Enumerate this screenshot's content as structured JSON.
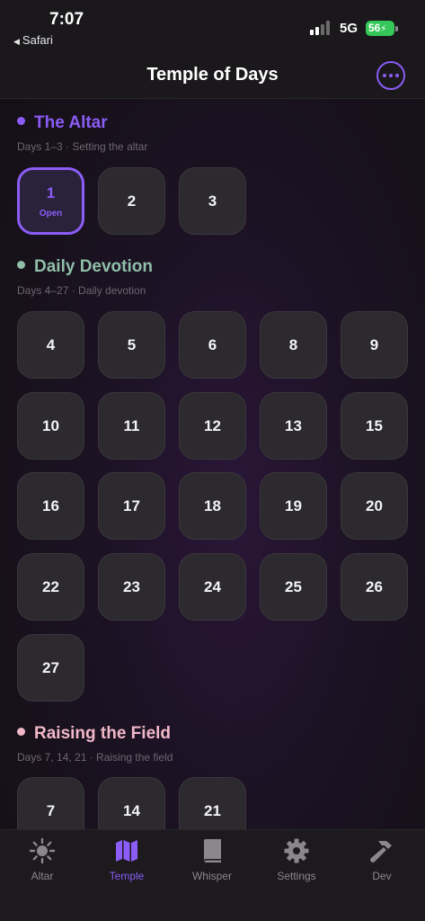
{
  "status_bar": {
    "time": "7:07",
    "back_app": "Safari",
    "network": "5G",
    "battery": "56"
  },
  "header": {
    "title": "Temple of Days",
    "accent": "#8b5cf6"
  },
  "sections": [
    {
      "title": "The Altar",
      "subtitle": "Days 1–3 · Setting the altar",
      "color": "#8b5cf6",
      "tiles": [
        {
          "label": "1",
          "status": "Open"
        },
        {
          "label": "2"
        },
        {
          "label": "3"
        }
      ]
    },
    {
      "title": "Daily Devotion",
      "subtitle": "Days 4–27 · Daily devotion",
      "color": "#8fbfa8",
      "tiles": [
        {
          "label": "4"
        },
        {
          "label": "5"
        },
        {
          "label": "6"
        },
        {
          "label": "8"
        },
        {
          "label": "9"
        },
        {
          "label": "10"
        },
        {
          "label": "11"
        },
        {
          "label": "12"
        },
        {
          "label": "13"
        },
        {
          "label": "15"
        },
        {
          "label": "16"
        },
        {
          "label": "17"
        },
        {
          "label": "18"
        },
        {
          "label": "19"
        },
        {
          "label": "20"
        },
        {
          "label": "22"
        },
        {
          "label": "23"
        },
        {
          "label": "24"
        },
        {
          "label": "25"
        },
        {
          "label": "26"
        },
        {
          "label": "27"
        }
      ]
    },
    {
      "title": "Raising the Field",
      "subtitle": "Days 7, 14, 21 · Raising the field",
      "color": "#f2b8c8",
      "tiles": [
        {
          "label": "7"
        },
        {
          "label": "14"
        },
        {
          "label": "21"
        }
      ]
    }
  ],
  "tab_bar": {
    "items": [
      {
        "label": "Altar",
        "icon": "sun-icon"
      },
      {
        "label": "Temple",
        "icon": "map-icon",
        "active": true
      },
      {
        "label": "Whisper",
        "icon": "book-icon"
      },
      {
        "label": "Settings",
        "icon": "gear-icon"
      },
      {
        "label": "Dev",
        "icon": "hammer-icon"
      }
    ]
  }
}
